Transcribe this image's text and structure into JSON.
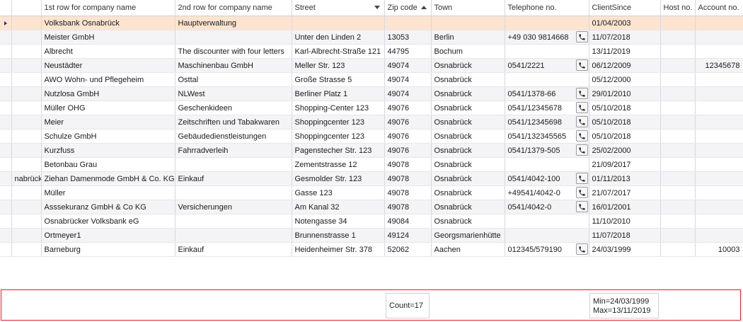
{
  "columns": {
    "first_row": "1st row for company name",
    "second_row": "2nd row for company name",
    "street": "Street",
    "zip": "Zip code",
    "town": "Town",
    "telephone": "Telephone no.",
    "client_since": "ClientSince",
    "host": "Host no.",
    "account": "Account no."
  },
  "rows": [
    {
      "lead": "",
      "name1": "Volksbank Osnabrück",
      "name2": "Hauptverwaltung",
      "street": "",
      "zip": "",
      "town": "",
      "phone": "",
      "since": "01/04/2003",
      "host": "",
      "account": ""
    },
    {
      "lead": "",
      "name1": "Meister GmbH",
      "name2": "",
      "street": "Unter den Linden 2",
      "zip": "13053",
      "town": "Berlin",
      "phone": "+49 030 9814668",
      "since": "11/07/2018",
      "host": "",
      "account": ""
    },
    {
      "lead": "",
      "name1": "Albrecht",
      "name2": "The discounter with four letters",
      "street": "Karl-Albrecht-Straße 121",
      "zip": "44795",
      "town": "Bochum",
      "phone": "",
      "since": "13/11/2019",
      "host": "",
      "account": ""
    },
    {
      "lead": "",
      "name1": "Neustädter",
      "name2": "Maschinenbau GmbH",
      "street": "Meller Str. 123",
      "zip": "49074",
      "town": "Osnabrück",
      "phone": "0541/2221",
      "since": "06/12/2009",
      "host": "",
      "account": "12345678"
    },
    {
      "lead": "",
      "name1": "AWO Wohn- und Pflegeheim",
      "name2": "Osttal",
      "street": "Große Strasse 5",
      "zip": "49074",
      "town": "Osnabrück",
      "phone": "",
      "since": "05/12/2000",
      "host": "",
      "account": ""
    },
    {
      "lead": "",
      "name1": "Nutzlosa GmbH",
      "name2": "NLWest",
      "street": "Berliner Platz 1",
      "zip": "49074",
      "town": "Osnabrück",
      "phone": "0541/1378-66",
      "since": "29/01/2010",
      "host": "",
      "account": ""
    },
    {
      "lead": "",
      "name1": "Müller OHG",
      "name2": "Geschenkideen",
      "street": "Shopping-Center 123",
      "zip": "49076",
      "town": "Osnabrück",
      "phone": "0541/12345678",
      "since": "05/10/2018",
      "host": "",
      "account": ""
    },
    {
      "lead": "",
      "name1": "Meier",
      "name2": "Zeitschriften und Tabakwaren",
      "street": "Shoppingcenter 123",
      "zip": "49076",
      "town": "Osnabrück",
      "phone": "0541/12345698",
      "since": "05/10/2018",
      "host": "",
      "account": ""
    },
    {
      "lead": "",
      "name1": "Schulze GmbH",
      "name2": "Gebäudedienstleistungen",
      "street": "Shoppingcenter 123",
      "zip": "49076",
      "town": "Osnabrück",
      "phone": "0541/132345565",
      "since": "05/10/2018",
      "host": "",
      "account": ""
    },
    {
      "lead": "",
      "name1": "Kurzfuss",
      "name2": "Fahrradverleih",
      "street": "Pagenstecher Str. 123",
      "zip": "49076",
      "town": "Osnabrück",
      "phone": "0541/1379-505",
      "since": "25/02/2000",
      "host": "",
      "account": ""
    },
    {
      "lead": "",
      "name1": "Betonbau Grau",
      "name2": "",
      "street": "Zementstrasse 12",
      "zip": "49078",
      "town": "Osnabrück",
      "phone": "",
      "since": "21/09/2017",
      "host": "",
      "account": ""
    },
    {
      "lead": "nabrück",
      "name1": "Ziehan Damenmode GmbH & Co. KG",
      "name2": "Einkauf",
      "street": "Gesmolder Str. 123",
      "zip": "49078",
      "town": "Osnabrück",
      "phone": "0541/4042-100",
      "since": "01/11/2013",
      "host": "",
      "account": ""
    },
    {
      "lead": "",
      "name1": "Müller",
      "name2": "",
      "street": "Gasse 123",
      "zip": "49078",
      "town": "Osnabrück",
      "phone": "+49541/4042-0",
      "since": "21/07/2017",
      "host": "",
      "account": ""
    },
    {
      "lead": "",
      "name1": "Asssekuranz GmbH & Co KG",
      "name2": "Versicherungen",
      "street": "Am Kanal 32",
      "zip": "49078",
      "town": "Osnabrück",
      "phone": "0541/4042-0",
      "since": "16/01/2001",
      "host": "",
      "account": ""
    },
    {
      "lead": "",
      "name1": "Osnabrücker Volksbank eG",
      "name2": "",
      "street": "Notengasse 34",
      "zip": "49084",
      "town": "Osnabrück",
      "phone": "",
      "since": "11/10/2010",
      "host": "",
      "account": ""
    },
    {
      "lead": "",
      "name1": "Ortmeyer1",
      "name2": "",
      "street": "Brunnenstrasse 1",
      "zip": "49124",
      "town": "Georgsmarienhütte",
      "phone": "",
      "since": "11/07/2018",
      "host": "",
      "account": ""
    },
    {
      "lead": "",
      "name1": "Barneburg",
      "name2": "Einkauf",
      "street": "Heidenheimer Str. 378",
      "zip": "52062",
      "town": "Aachen",
      "phone": "012345/579190",
      "since": "24/03/1999",
      "host": "",
      "account": "10003"
    }
  ],
  "footer": {
    "count": "Count=17",
    "min": "Min=24/03/1999",
    "max": "Max=13/11/2019"
  },
  "colors": {
    "selected_row": "#fce4d0",
    "footer_border": "#e02020",
    "row_pointer": "#223a6e"
  },
  "icons": {
    "phone": "phone-icon",
    "row_pointer": "row-pointer-icon",
    "sort_desc": "sort-descending-icon",
    "sort_asc": "sort-ascending-icon"
  }
}
